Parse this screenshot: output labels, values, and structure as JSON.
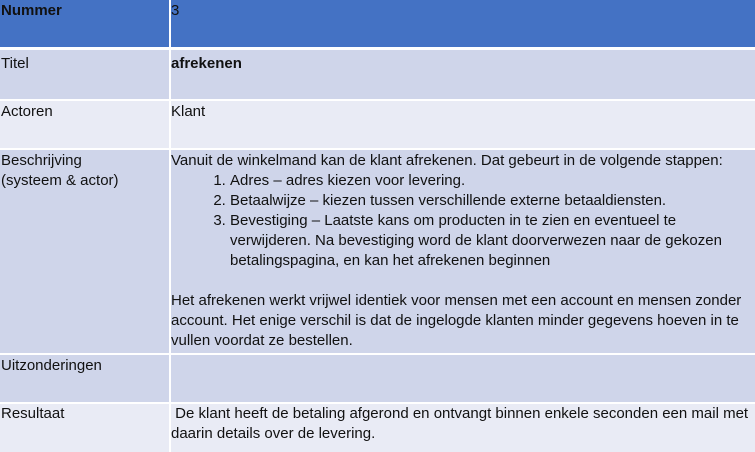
{
  "rows": {
    "nummer": {
      "label": "Nummer",
      "value": "3"
    },
    "titel": {
      "label": "Titel",
      "value": "afrekenen"
    },
    "actoren": {
      "label": "Actoren",
      "value": "Klant"
    },
    "beschrijving": {
      "label_line1": "Beschrijving",
      "label_line2": "(systeem & actor)",
      "intro": "Vanuit de winkelmand kan de klant afrekenen. Dat gebeurt in de volgende stappen:",
      "steps": [
        "Adres – adres kiezen voor levering.",
        "Betaalwijze – kiezen tussen verschillende externe betaaldiensten.",
        "Bevestiging – Laatste kans om producten in te zien en eventueel te verwijderen. Na bevestiging word de klant doorverwezen naar de gekozen betalingspagina, en kan het afrekenen beginnen"
      ],
      "outro": "Het afrekenen werkt vrijwel identiek voor mensen met een account en mensen zonder account. Het enige verschil is dat de ingelogde klanten minder gegevens hoeven in te vullen voordat ze bestellen."
    },
    "uitzonderingen": {
      "label": "Uitzonderingen",
      "value": ""
    },
    "resultaat": {
      "label": "Resultaat",
      "value": " De klant heeft de betaling afgerond en ontvangt binnen enkele seconden een mail met daarin details over de levering."
    }
  },
  "colors": {
    "header": "#4472c4",
    "row_light": "#e9ebf5",
    "row_mid": "#cfd5ea"
  }
}
